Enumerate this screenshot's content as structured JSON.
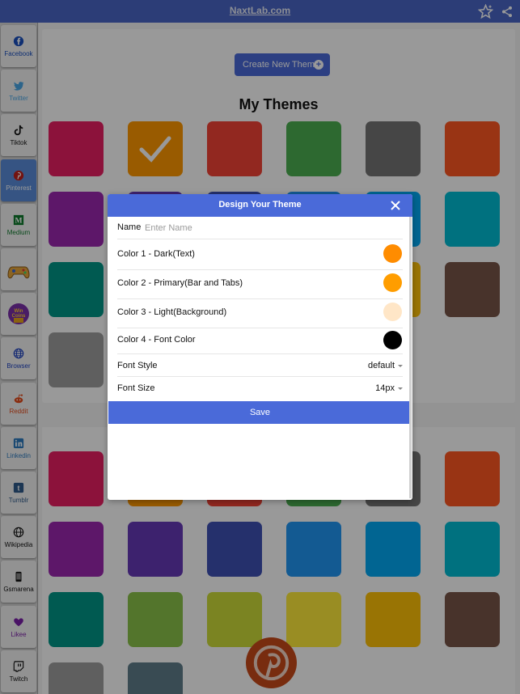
{
  "topbar": {
    "site": "NaxtLab.com",
    "star_icon": "star-icon",
    "share_icon": "share-icon"
  },
  "sidebar": {
    "items": [
      {
        "label": "Facebook",
        "icon": "facebook-icon",
        "color": "#1a4fbf"
      },
      {
        "label": "Twitter",
        "icon": "twitter-icon",
        "color": "#4aa7e6"
      },
      {
        "label": "Tiktok",
        "icon": "tiktok-icon",
        "color": "#111111"
      },
      {
        "label": "Pinterest",
        "icon": "pinterest-icon",
        "color": "#c0201b"
      },
      {
        "label": "Medium",
        "icon": "medium-icon",
        "color": "#0e7a2c"
      },
      {
        "label": "",
        "icon": "game-controller-icon",
        "color": "#e8a73b"
      },
      {
        "label": "",
        "icon": "win-coins-icon",
        "color": "#7a2fa8"
      },
      {
        "label": "Browser",
        "icon": "globe-icon",
        "color": "#1a3fbf"
      },
      {
        "label": "Reddit",
        "icon": "reddit-icon",
        "color": "#e44b1b"
      },
      {
        "label": "Linkedin",
        "icon": "linkedin-icon",
        "color": "#2e7bbf"
      },
      {
        "label": "Tumblr",
        "icon": "tumblr-icon",
        "color": "#2f5b8a"
      },
      {
        "label": "Wikipedia",
        "icon": "wikipedia-icon",
        "color": "#111111"
      },
      {
        "label": "Gsmarena",
        "icon": "phone-icon",
        "color": "#111111"
      },
      {
        "label": "Likee",
        "icon": "heart-icon",
        "color": "#7a1fa8"
      },
      {
        "label": "Twitch",
        "icon": "twitch-icon",
        "color": "#111111"
      }
    ]
  },
  "main": {
    "create_button": "Create New Theme",
    "my_themes_title": "My Themes",
    "swatch_colors_top": [
      "#e91e63",
      "#ff9800",
      "#f44336",
      "#4caf50",
      "#757575",
      "#ff5722",
      "#9c27b0",
      "#673ab7",
      "#3f51b5",
      "#2196f3",
      "#03a9f4",
      "#00bcd4",
      "#009688",
      "#8bc34a",
      "#cddc39",
      "#ffeb3b",
      "#ffc107",
      "#795548",
      "#9e9e9e"
    ],
    "swatch_colors_bottom": [
      "#e91e63",
      "#ff9800",
      "#f44336",
      "#4caf50",
      "#757575",
      "#ff5722",
      "#9c27b0",
      "#673ab7",
      "#3f51b5",
      "#2196f3",
      "#03a9f4",
      "#00bcd4",
      "#009688",
      "#8bc34a",
      "#cddc39",
      "#ffeb3b",
      "#ffc107",
      "#795548",
      "#9e9e9e",
      "#607d8b"
    ]
  },
  "modal": {
    "title": "Design Your Theme",
    "name_label": "Name",
    "name_placeholder": "Enter Name",
    "name_value": "",
    "colors": [
      {
        "label": "Color 1 - Dark(Text)",
        "value": "#ff8c00"
      },
      {
        "label": "Color 2 - Primary(Bar and Tabs)",
        "value": "#ff9d00"
      },
      {
        "label": "Color 3 - Light(Background)",
        "value": "#ffe6c7"
      },
      {
        "label": "Color 4 - Font Color",
        "value": "#000000"
      }
    ],
    "font_style_label": "Font Style",
    "font_style_value": "default",
    "font_size_label": "Font Size",
    "font_size_value": "14px",
    "save_label": "Save"
  },
  "fab": {
    "icon": "pinterest-icon"
  }
}
